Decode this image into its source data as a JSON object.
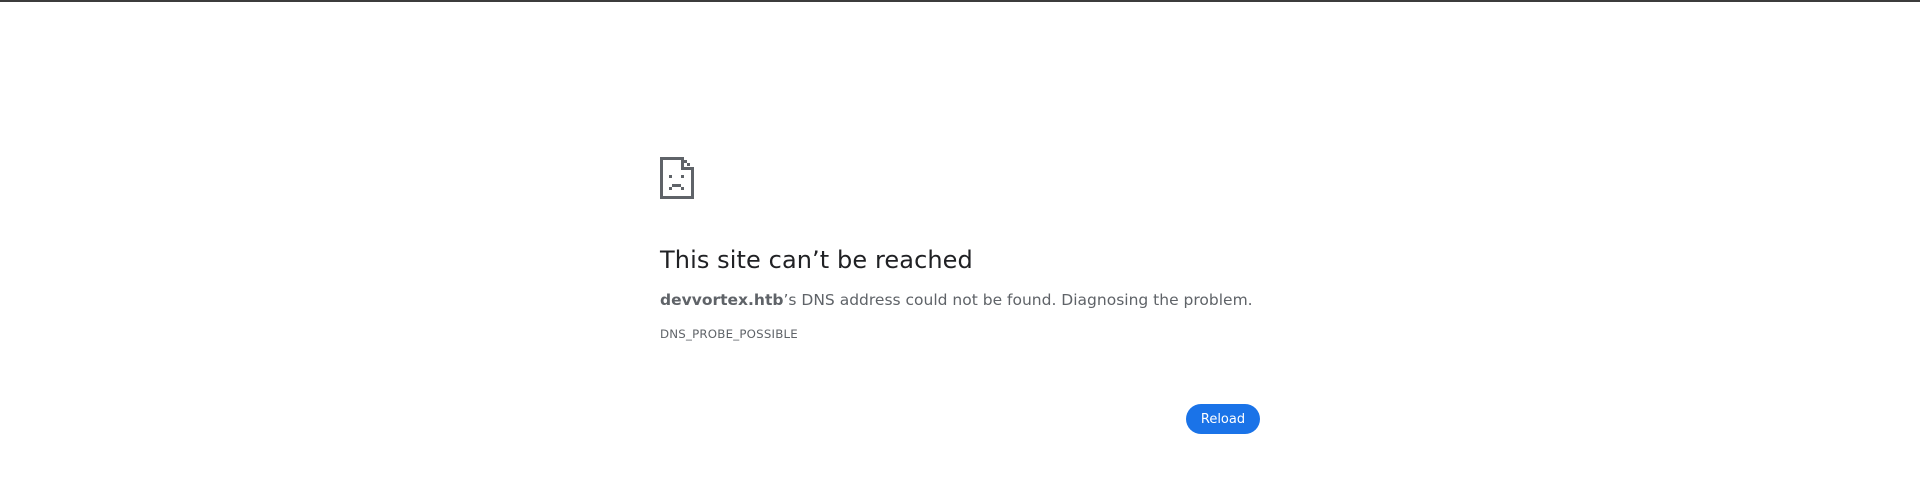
{
  "error_page": {
    "icon": "sad-file-icon",
    "heading": "This site can’t be reached",
    "host": "devvortex.htb",
    "description_suffix": "’s DNS address could not be found. Diagnosing the problem.",
    "error_code": "DNS_PROBE_POSSIBLE",
    "reload_label": "Reload"
  },
  "colors": {
    "accent": "#1a73e8",
    "heading_text": "#202124",
    "secondary_text": "#5f6368",
    "icon": "#5f6368"
  }
}
